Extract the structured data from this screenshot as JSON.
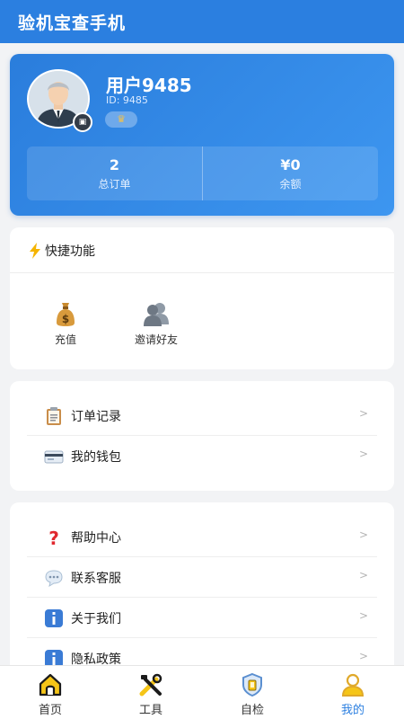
{
  "app": {
    "title": "验机宝查手机"
  },
  "profile": {
    "username": "用户9485",
    "user_id": "ID: 9485",
    "level_badge": "crown-icon",
    "stats": [
      {
        "value": "2",
        "label": "总订单"
      },
      {
        "value": "¥0",
        "label": "余额"
      }
    ]
  },
  "quick": {
    "title": "快捷功能",
    "icon": "lightning-icon",
    "items": [
      {
        "label": "充值",
        "icon": "money-bag-icon"
      },
      {
        "label": "邀请好友",
        "icon": "people-icon"
      }
    ]
  },
  "menu_group_1": [
    {
      "label": "订单记录",
      "icon": "clipboard-icon",
      "arrow": ">"
    },
    {
      "label": "我的钱包",
      "icon": "credit-card-icon",
      "arrow": ">"
    }
  ],
  "menu_group_2": [
    {
      "label": "帮助中心",
      "icon": "question-icon",
      "arrow": ">"
    },
    {
      "label": "联系客服",
      "icon": "chat-bubble-icon",
      "arrow": ">"
    },
    {
      "label": "关于我们",
      "icon": "info-icon",
      "arrow": ">"
    },
    {
      "label": "隐私政策",
      "icon": "info-icon",
      "arrow": ">"
    }
  ],
  "tabbar": {
    "active": "我的",
    "tabs": [
      {
        "label": "首页",
        "icon": "home-icon"
      },
      {
        "label": "工具",
        "icon": "tools-icon"
      },
      {
        "label": "自检",
        "icon": "shield-icon"
      },
      {
        "label": "我的",
        "icon": "user-icon"
      }
    ]
  },
  "colors": {
    "primary": "#2b7fe0",
    "background": "#f2f3f5",
    "accent_gold": "#f3c24a"
  }
}
